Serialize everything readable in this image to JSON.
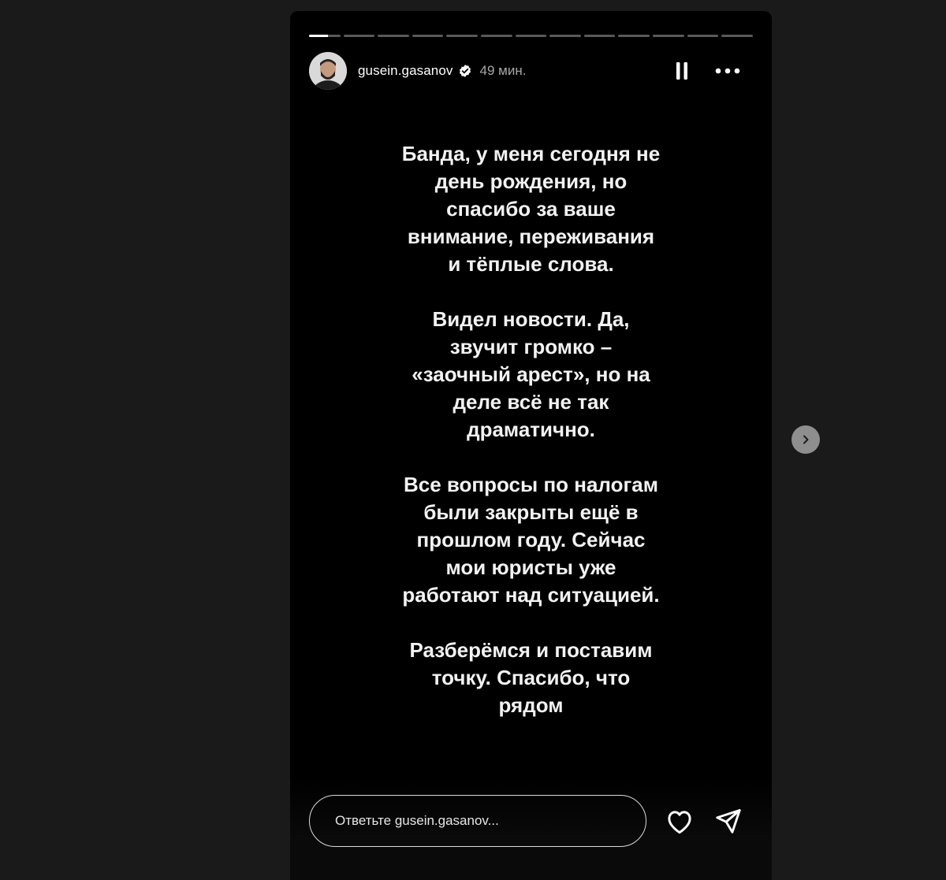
{
  "story": {
    "progress": {
      "segments": 13,
      "current_index": 0,
      "current_fill": 0.6
    },
    "header": {
      "username": "gusein.gasanov",
      "time_ago": "49 мин.",
      "verified": true
    },
    "paragraphs": [
      [
        "Банда, у меня сегодня не",
        "день рождения, но",
        "спасибо за ваше",
        "внимание, переживания",
        "и тёплые слова."
      ],
      [
        "Видел новости. Да,",
        "звучит громко –",
        "«заочный арест», но на",
        "деле всё не так",
        "драматично."
      ],
      [
        "Все вопросы по налогам",
        "были закрыты ещё в",
        "прошлом году. Сейчас",
        "мои юристы уже",
        "работают над ситуацией."
      ],
      [
        "Разберёмся и поставим",
        "точку. Спасибо, что",
        "рядом"
      ]
    ],
    "reply": {
      "placeholder": "Ответьте gusein.gasanov..."
    }
  },
  "icons": {
    "pause": "pause-icon",
    "more": "more-icon",
    "verified": "verified-badge-icon",
    "like": "heart-icon",
    "share": "send-icon",
    "next": "chevron-right-icon"
  },
  "colors": {
    "page_background": "#1a1a1a",
    "story_background": "#000000",
    "text": "#f2f2f2",
    "muted": "#a8a8a8",
    "verified": "#ffffff",
    "next_button": "#8e8e8e"
  }
}
